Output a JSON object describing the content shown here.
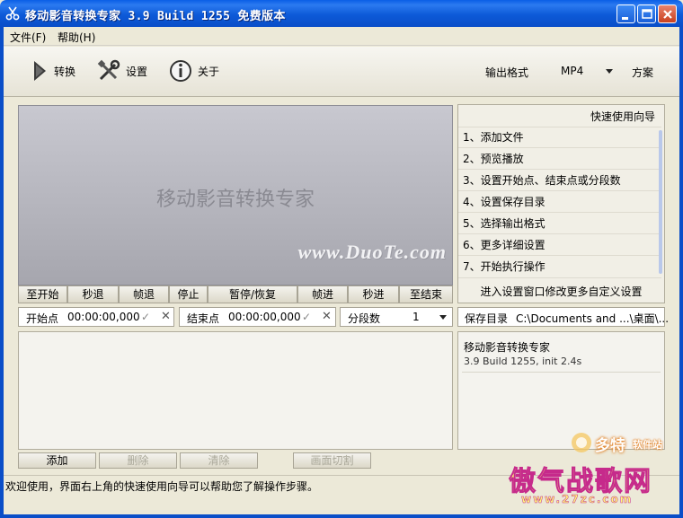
{
  "window": {
    "title": "移动影音转换专家 3.9 Build 1255 免费版本"
  },
  "menu": {
    "file": "文件(F)",
    "help": "帮助(H)"
  },
  "toolbar": {
    "convert": "转换",
    "settings": "设置",
    "about": "关于",
    "output_format_label": "输出格式",
    "output_format_value": "MP4",
    "scheme": "方案"
  },
  "preview": {
    "placeholder": "移动影音转换专家",
    "watermark": "www.DuoTe.com"
  },
  "playback": [
    "至开始",
    "秒退",
    "帧退",
    "停止",
    "暂停/恢复",
    "帧进",
    "秒进",
    "至结束"
  ],
  "wizard": {
    "title": "快速使用向导",
    "steps": [
      "1、添加文件",
      "2、预览播放",
      "3、设置开始点、结束点或分段数",
      "4、设置保存目录",
      "5、选择输出格式",
      "6、更多详细设置",
      "7、开始执行操作"
    ],
    "footer": "进入设置窗口修改更多自定义设置"
  },
  "clip": {
    "start_label": "开始点",
    "start_value": "00:00:00,000",
    "end_label": "结束点",
    "end_value": "00:00:00,000",
    "segments_label": "分段数",
    "segments_value": "1"
  },
  "save": {
    "label": "保存目录",
    "path": "C:\\Documents and ...\\桌面\\..."
  },
  "info": {
    "title": "移动影音转换专家",
    "version": "3.9 Build 1255, init 2.4s"
  },
  "actions": {
    "add": "添加",
    "delete": "删除",
    "clear": "清除",
    "cut": "画面切割"
  },
  "status": {
    "message": "欢迎使用，界面右上角的快速使用向导可以帮助您了解操作步骤。",
    "url_fragment": "http"
  },
  "watermarks": {
    "brand": "傲气战歌网",
    "brand_url": "www.27zc.com",
    "duote_name": "多特",
    "duote_sub": "软件站"
  }
}
